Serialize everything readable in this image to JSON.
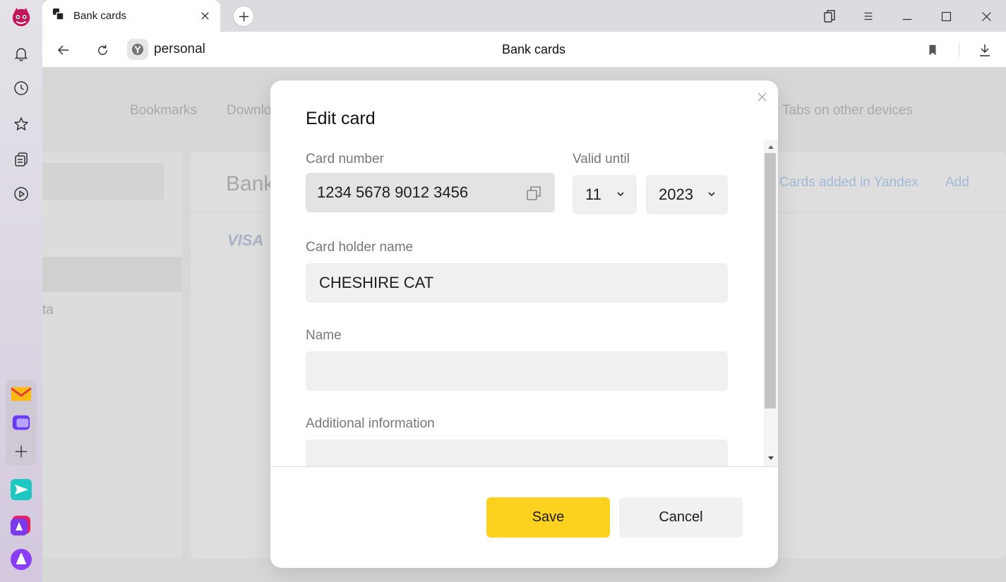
{
  "window": {
    "tab_title": "Bank cards",
    "address_text": "personal",
    "page_title": "Bank cards"
  },
  "page": {
    "nav_tabs": [
      "Bookmarks",
      "Downlo",
      "Tabs on other devices"
    ],
    "section_title": "Bank",
    "cards_added_link": "Cards added in Yandex",
    "add_link": "Add",
    "card_brand": "VISA",
    "left_partial_text": "ta"
  },
  "modal": {
    "title": "Edit card",
    "card_number_label": "Card number",
    "card_number_value": "1234 5678 9012 3456",
    "valid_until_label": "Valid until",
    "month_value": "11",
    "year_value": "2023",
    "card_holder_label": "Card holder name",
    "card_holder_value": "CHESHIRE CAT",
    "name_label": "Name",
    "name_value": "",
    "additional_label": "Additional information",
    "additional_value": "",
    "save_label": "Save",
    "cancel_label": "Cancel"
  },
  "colors": {
    "save_button": "#fcd21e",
    "link": "#a3b8d6",
    "field_bg": "#f0f0f0"
  }
}
